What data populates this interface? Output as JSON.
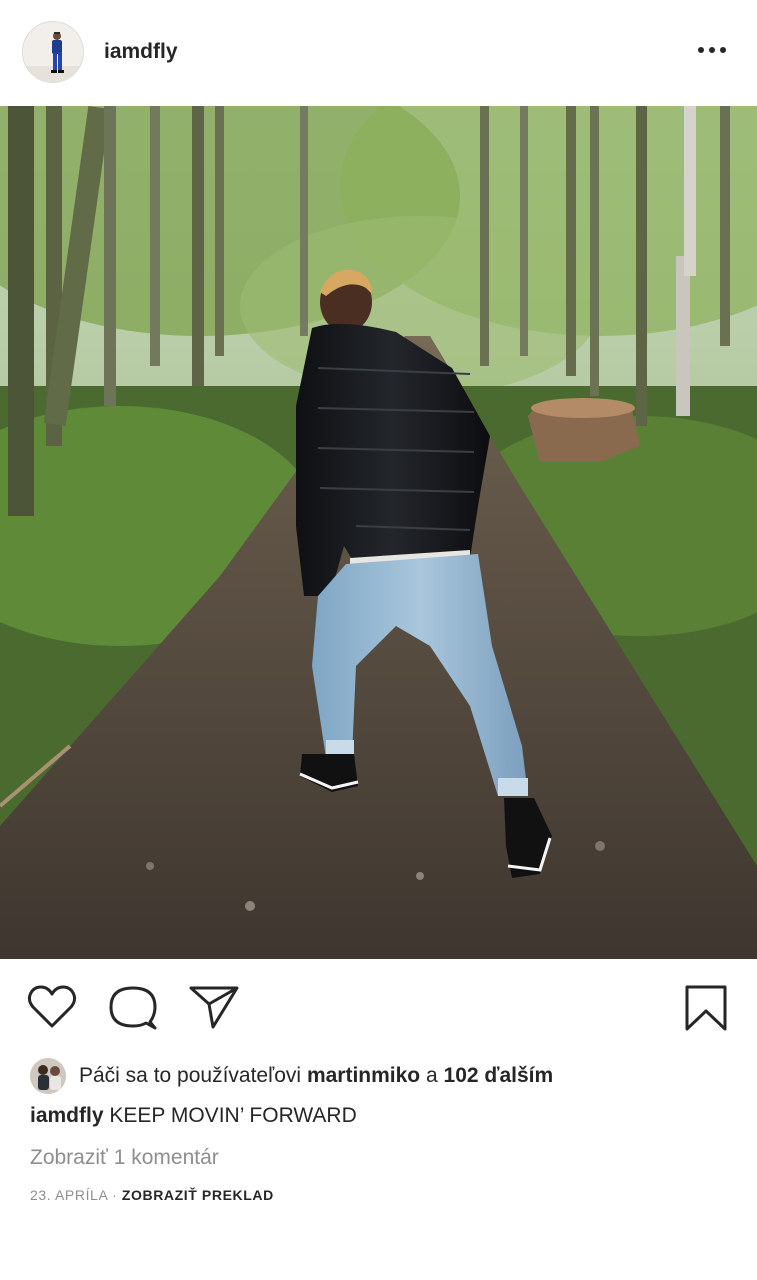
{
  "post": {
    "username": "iamdfly",
    "caption_username": "iamdfly",
    "caption_text": "KEEP MOVIN’ FORWARD"
  },
  "icons": {
    "more": "more-horizontal-icon",
    "like": "heart-icon",
    "comment": "comment-bubble-icon",
    "share": "paper-plane-icon",
    "save": "bookmark-icon"
  },
  "likes": {
    "prefix": "Páči sa to používateľovi",
    "user": "martinmiko",
    "connector": "a",
    "others": "102 ďalším"
  },
  "comments": {
    "view_label": "Zobraziť 1 komentár"
  },
  "meta": {
    "date": "23. apríla",
    "separator": "·",
    "translate_label": "Zobraziť preklad"
  },
  "colors": {
    "text": "#262626",
    "secondary": "#8e8e8e",
    "background": "#ffffff"
  }
}
